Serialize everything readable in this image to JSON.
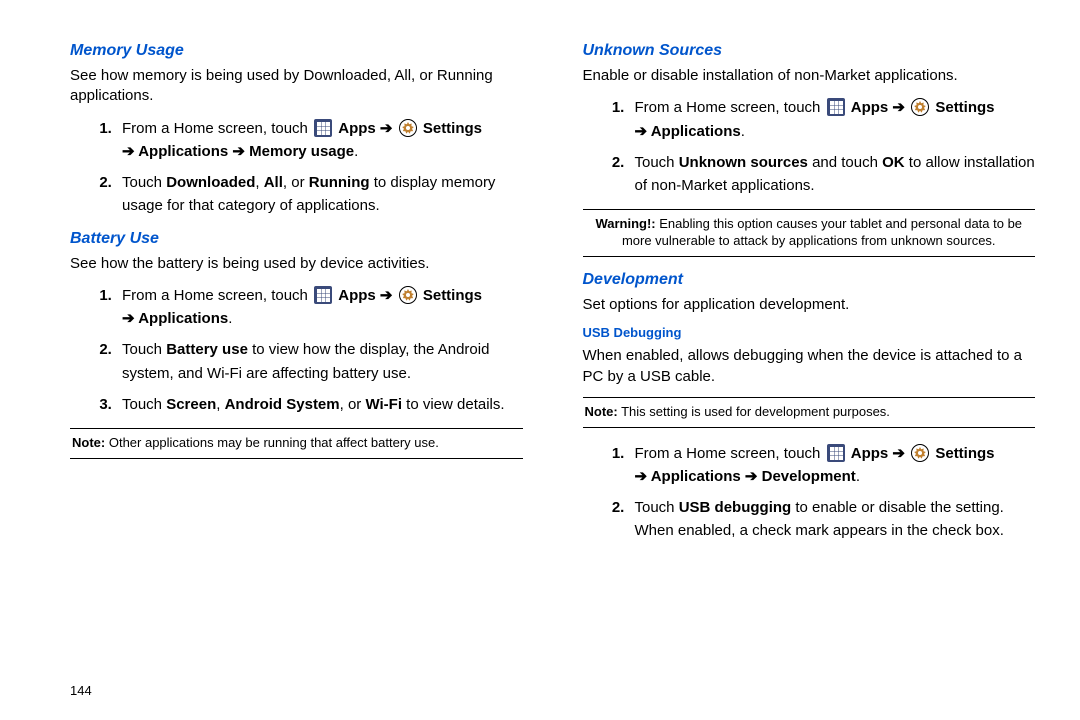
{
  "page_number": "144",
  "labels": {
    "apps": "Apps",
    "settings": "Settings",
    "arrow": "➔",
    "from_home": "From a Home screen, touch",
    "note_prefix": "Note:",
    "warn_prefix": "Warning!:"
  },
  "left": {
    "memory": {
      "heading": "Memory Usage",
      "intro": "See how memory is being used by Downloaded, All, or Running applications.",
      "path_tail": "Applications ➔ Memory usage",
      "step2_pre": "Touch ",
      "step2_b1": "Downloaded",
      "step2_mid1": ", ",
      "step2_b2": "All",
      "step2_mid2": ", or ",
      "step2_b3": "Running",
      "step2_post": " to display memory usage for that category of applications."
    },
    "battery": {
      "heading": "Battery Use",
      "intro": "See how the battery is being used by device activities.",
      "path_tail": "Applications",
      "step2_pre": "Touch ",
      "step2_b1": "Battery use",
      "step2_post": " to view how the display, the Android system, and Wi-Fi are affecting battery use.",
      "step3_pre": "Touch ",
      "step3_b1": "Screen",
      "step3_mid1": ", ",
      "step3_b2": "Android System",
      "step3_mid2": ", or ",
      "step3_b3": "Wi-Fi",
      "step3_post": " to view details.",
      "note": "Other applications may be running that affect battery use."
    }
  },
  "right": {
    "unknown": {
      "heading": "Unknown Sources",
      "intro": "Enable or disable installation of non-Market applications.",
      "path_tail": "Applications",
      "step2_pre": "Touch ",
      "step2_b1": "Unknown sources",
      "step2_mid": " and touch ",
      "step2_b2": "OK",
      "step2_post": " to allow installation of non-Market applications.",
      "warning": "Enabling this option causes your tablet and personal data to be more vulnerable to attack by applications from unknown sources."
    },
    "dev": {
      "heading": "Development",
      "intro": "Set options for application development.",
      "sub": "USB Debugging",
      "desc": "When enabled, allows debugging when the device is attached to a PC by a USB cable.",
      "note": "This setting is used for development purposes.",
      "path_tail": "Applications ➔ Development",
      "step2_pre": "Touch ",
      "step2_b1": "USB debugging",
      "step2_post": " to enable or disable the setting. When enabled, a check mark appears in the check box."
    }
  }
}
